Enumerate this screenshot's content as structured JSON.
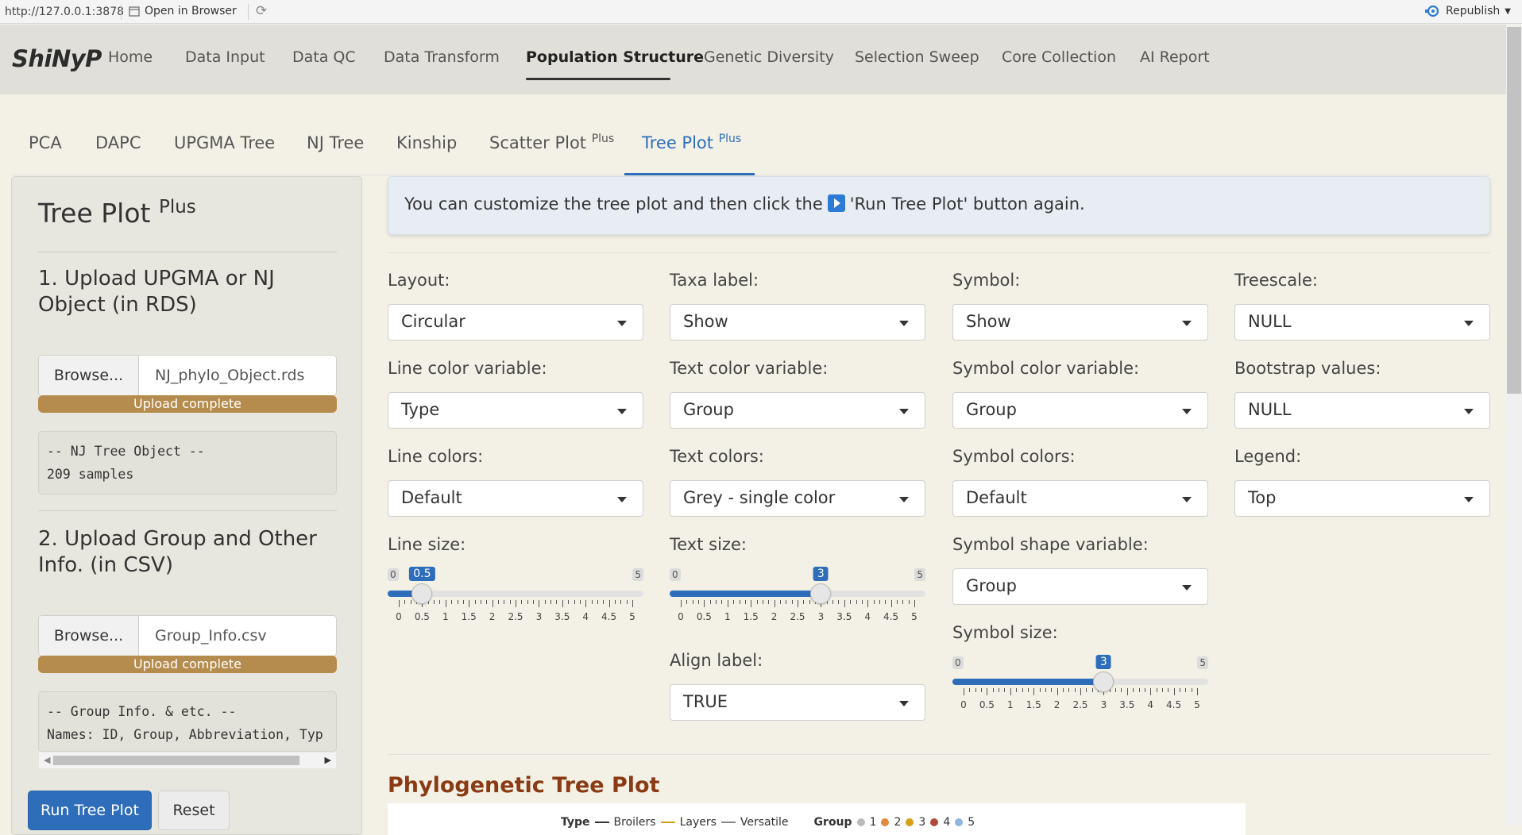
{
  "topbar": {
    "url": "http://127.0.0.1:3878",
    "open_in_browser": "Open in Browser",
    "republish": "Republish"
  },
  "navbar": {
    "brand": "ShiNyP",
    "items": [
      "Home",
      "Data Input",
      "Data QC",
      "Data Transform",
      "Population Structure",
      "Genetic Diversity",
      "Selection Sweep",
      "Core Collection",
      "AI Report"
    ],
    "active": "Population Structure"
  },
  "subtabs": {
    "items": [
      "PCA",
      "DAPC",
      "UPGMA Tree",
      "NJ Tree",
      "Kinship",
      "Scatter Plot",
      "Tree Plot"
    ],
    "plus": "Plus",
    "active": "Tree Plot"
  },
  "sidebar": {
    "title": "Tree Plot",
    "title_sup": "Plus",
    "section1": "1. Upload UPGMA or NJ Object (in RDS)",
    "file1": {
      "browse": "Browse...",
      "name": "NJ_phylo_Object.rds",
      "status": "Upload complete"
    },
    "info1": [
      "-- NJ Tree Object --",
      "209 samples"
    ],
    "section2": "2. Upload Group and Other Info. (in CSV)",
    "file2": {
      "browse": "Browse...",
      "name": "Group_Info.csv",
      "status": "Upload complete"
    },
    "info2": [
      "-- Group Info. & etc. --",
      "Names: ID, Group, Abbreviation, Typ"
    ],
    "run_button": "Run Tree Plot",
    "reset_button": "Reset"
  },
  "info_box": {
    "before": "You can customize the tree plot and then click the",
    "after": "'Run Tree Plot' button again."
  },
  "controls": {
    "layout": {
      "label": "Layout:",
      "value": "Circular"
    },
    "taxa_label": {
      "label": "Taxa label:",
      "value": "Show"
    },
    "symbol": {
      "label": "Symbol:",
      "value": "Show"
    },
    "treescale": {
      "label": "Treescale:",
      "value": "NULL"
    },
    "line_color_var": {
      "label": "Line color variable:",
      "value": "Type"
    },
    "text_color_var": {
      "label": "Text color variable:",
      "value": "Group"
    },
    "symbol_color_var": {
      "label": "Symbol color variable:",
      "value": "Group"
    },
    "bootstrap": {
      "label": "Bootstrap values:",
      "value": "NULL"
    },
    "line_colors": {
      "label": "Line colors:",
      "value": "Default"
    },
    "text_colors": {
      "label": "Text colors:",
      "value": "Grey - single color"
    },
    "symbol_colors": {
      "label": "Symbol colors:",
      "value": "Default"
    },
    "legend": {
      "label": "Legend:",
      "value": "Top"
    },
    "line_size": {
      "label": "Line size:",
      "min": 0,
      "max": 5,
      "value": 0.5,
      "display": "0.5",
      "min_label": "0",
      "max_label": "5"
    },
    "text_size": {
      "label": "Text size:",
      "min": 0,
      "max": 5,
      "value": 3,
      "display": "3",
      "min_label": "0",
      "max_label": "5"
    },
    "symbol_shape_var": {
      "label": "Symbol shape variable:",
      "value": "Group"
    },
    "symbol_size": {
      "label": "Symbol size:",
      "min": 0,
      "max": 5,
      "value": 3,
      "display": "3",
      "min_label": "0",
      "max_label": "5"
    },
    "align_label": {
      "label": "Align label:",
      "value": "TRUE"
    },
    "tick_labels": [
      "0",
      "0.5",
      "1",
      "1.5",
      "2",
      "2.5",
      "3",
      "3.5",
      "4",
      "4.5",
      "5"
    ]
  },
  "plot": {
    "title": "Phylogenetic Tree Plot",
    "legend_type_title": "Type",
    "legend_types": [
      {
        "name": "Broilers",
        "color": "#333333"
      },
      {
        "name": "Layers",
        "color": "#d4a017"
      },
      {
        "name": "Versatile",
        "color": "#888888"
      }
    ],
    "legend_group_title": "Group",
    "legend_groups": [
      {
        "name": "1",
        "color": "#bbbbbb"
      },
      {
        "name": "2",
        "color": "#e08a3c"
      },
      {
        "name": "3",
        "color": "#d4a017"
      },
      {
        "name": "4",
        "color": "#b04a3a"
      },
      {
        "name": "5",
        "color": "#8fb6e0"
      }
    ]
  },
  "colors": {
    "accent": "#2e6dba",
    "progress": "#b58c4d",
    "plot_title": "#8a3b14"
  }
}
